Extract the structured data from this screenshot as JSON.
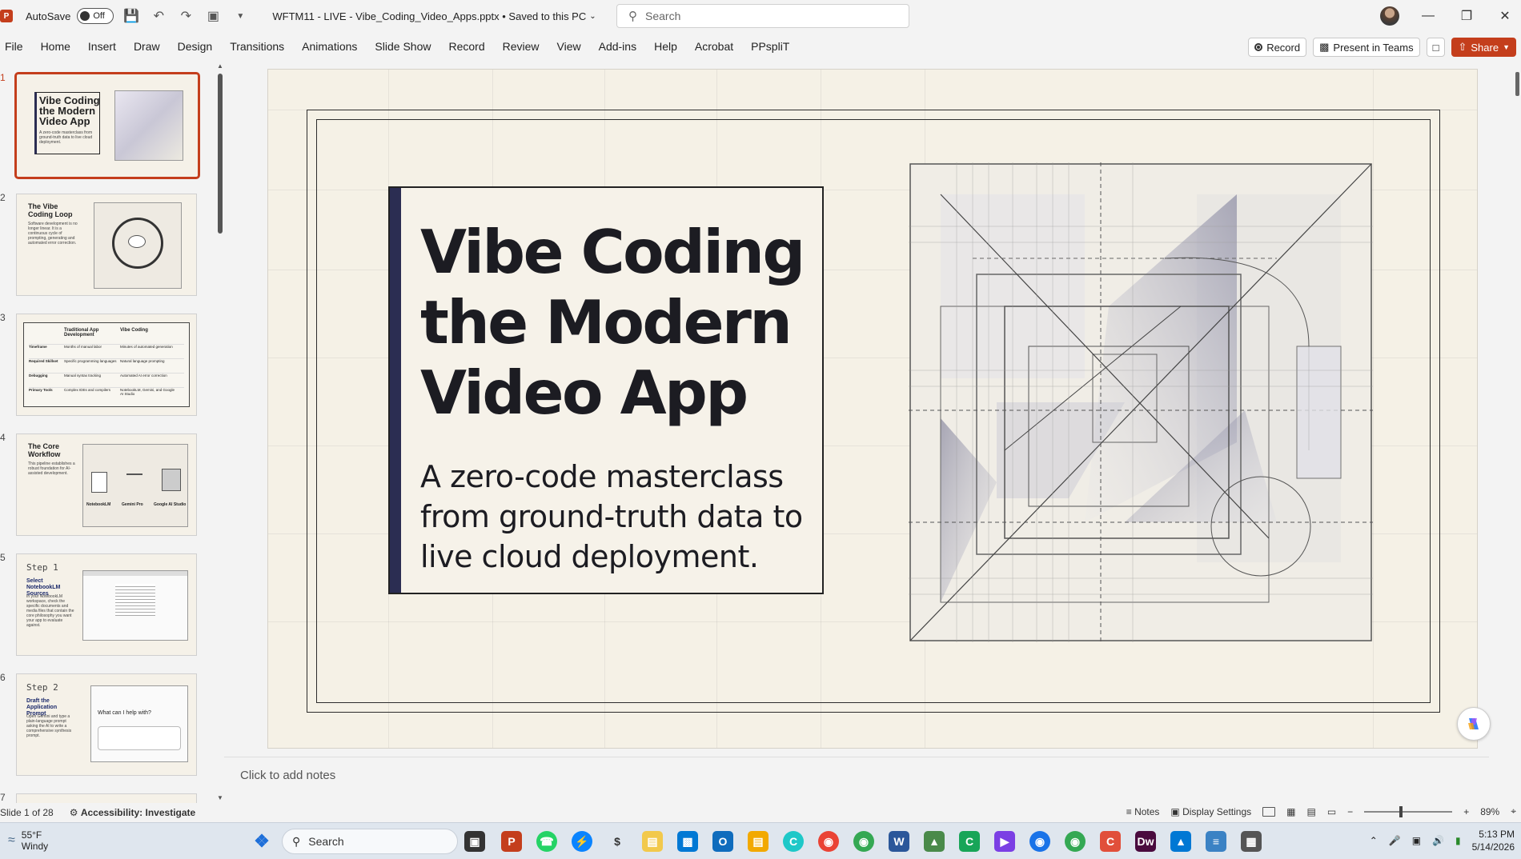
{
  "titlebar": {
    "autosave_label": "AutoSave",
    "autosave_state": "Off",
    "document_title": "WFTM11 - LIVE - Vibe_Coding_Video_Apps.pptx • Saved to this PC",
    "search_placeholder": "Search"
  },
  "ribbon": {
    "tabs": [
      "File",
      "Home",
      "Insert",
      "Draw",
      "Design",
      "Transitions",
      "Animations",
      "Slide Show",
      "Record",
      "Review",
      "View",
      "Add-ins",
      "Help",
      "Acrobat",
      "PPspliT"
    ],
    "record_label": "Record",
    "present_label": "Present in Teams",
    "share_label": "Share"
  },
  "thumbnails": [
    {
      "num": "1",
      "title": "Vibe Coding the Modern Video App",
      "body": "A zero-code masterclass from ground-truth data to live cloud deployment."
    },
    {
      "num": "2",
      "title": "The Vibe Coding Loop",
      "body": "Software development is no longer linear. It is a continuous cycle of prompting, generating and automated error correction."
    },
    {
      "num": "3",
      "table_headers": [
        "",
        "Traditional App Development",
        "Vibe Coding"
      ],
      "rows": [
        [
          "Timeframe",
          "Months of manual labor",
          "Minutes of automated generation"
        ],
        [
          "Required Skillset",
          "Specific programming languages",
          "Natural language prompting"
        ],
        [
          "Debugging",
          "Manual syntax tracking",
          "Automated AI error correction"
        ],
        [
          "Primary Tools",
          "Complex IDEs and compilers",
          "NotebookLM, Gemini, and Google AI Studio"
        ]
      ]
    },
    {
      "num": "4",
      "title": "The Core Workflow",
      "body": "This pipeline establishes a robust foundation for AI-assisted development.",
      "labels": [
        "NotebookLM",
        "Gemini Pro",
        "Google AI Studio"
      ]
    },
    {
      "num": "5",
      "step": "Step 1",
      "subtitle": "Select NotebookLM Sources",
      "body": "In your NotebookLM workspace, check the specific documents and media files that contain the core philosophy you want your app to evaluate against."
    },
    {
      "num": "6",
      "step": "Step 2",
      "subtitle": "Draft the Application Prompt",
      "body": "Open Gemini and type a plain-language prompt asking the AI to write a comprehensive synthesis prompt.",
      "chat_prompt": "What can I help with?"
    },
    {
      "num": "7"
    }
  ],
  "slide": {
    "title": "Vibe Coding the Modern Video App",
    "subtitle": "A zero-code masterclass from ground-truth data to live cloud deployment."
  },
  "notes_placeholder": "Click to add notes",
  "status": {
    "slide_counter": "Slide 1 of 28",
    "accessibility": "Accessibility: Investigate",
    "notes_label": "Notes",
    "display_settings": "Display Settings",
    "zoom": "89%"
  },
  "taskbar": {
    "temperature": "55°F",
    "weather": "Windy",
    "search_label": "Search",
    "time": "5:13 PM",
    "date": "5/14/2026"
  },
  "colors": {
    "accent": "#c43e1c",
    "slide_bg": "#f5f1e6",
    "title_bar": "#2b2d52"
  }
}
